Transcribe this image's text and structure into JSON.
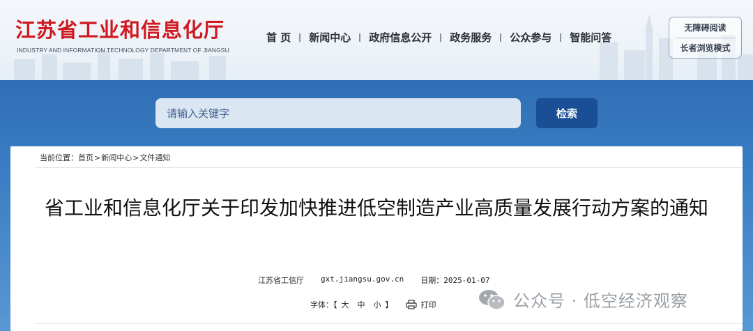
{
  "site": {
    "title": "江苏省工业和信息化厅",
    "subtitle": "INDUSTRY AND INFORMATION TECHNOLOGY DEPARTMENT OF JIANGSU"
  },
  "nav": {
    "items": [
      "首 页",
      "新闻中心",
      "政府信息公开",
      "政务服务",
      "公众参与",
      "智能问答"
    ]
  },
  "modes": {
    "accessible": "无障碍阅读",
    "elder": "长者浏览模式"
  },
  "search": {
    "placeholder": "请输入关键字",
    "button": "检索"
  },
  "breadcrumb": {
    "prefix": "当前位置：",
    "items": [
      "首页",
      "新闻中心",
      "文件通知"
    ],
    "separator": ">"
  },
  "article": {
    "title": "省工业和信息化厅关于印发加快推进低空制造产业高质量发展行动方案的通知",
    "source": "江苏省工信厅",
    "site": "gxt.jiangsu.gov.cn",
    "date_label": "日期：",
    "date": "2025-01-07",
    "font_label": "字体：【",
    "font_sizes": [
      "大",
      "中",
      "小"
    ],
    "font_close": "】",
    "print": "打印"
  },
  "watermark": {
    "text": "公众号 · 低空经济观察"
  },
  "colors": {
    "brand_red": "#d0181f",
    "band_blue": "#3b7fc4",
    "search_button": "#1a4f95"
  }
}
